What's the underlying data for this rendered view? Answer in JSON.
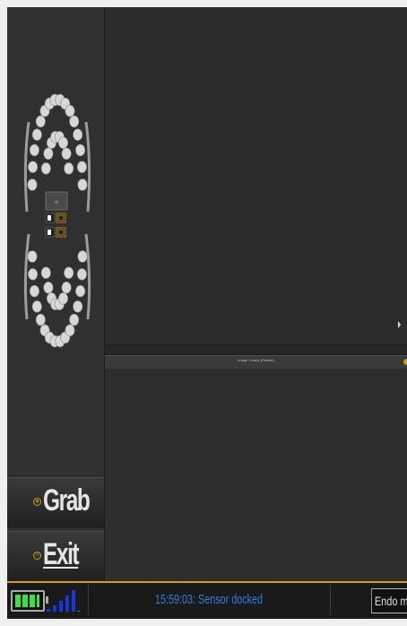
{
  "image_library": {
    "title": "Image Library (Patient)"
  },
  "chart": {
    "teeth_upper": 16,
    "teeth_lower": 16,
    "colors": {
      "tooth": "#d7d7d7",
      "gold": "#c99b1f",
      "bg": "#303030"
    }
  },
  "buttons": {
    "grab": {
      "label": "Grab",
      "icon": "camera-icon"
    },
    "exit": {
      "label": "Exit",
      "icon": "power-icon"
    }
  },
  "status_bar": {
    "message": "15:59:03: Sensor docked",
    "mode": "Endo mode",
    "battery_level": 1.0,
    "signal_bars": 5,
    "colors": {
      "accent": "#d4a019",
      "message": "#2f7fe0",
      "battery": "#3ee03e",
      "signal": "#1a36d8"
    }
  }
}
